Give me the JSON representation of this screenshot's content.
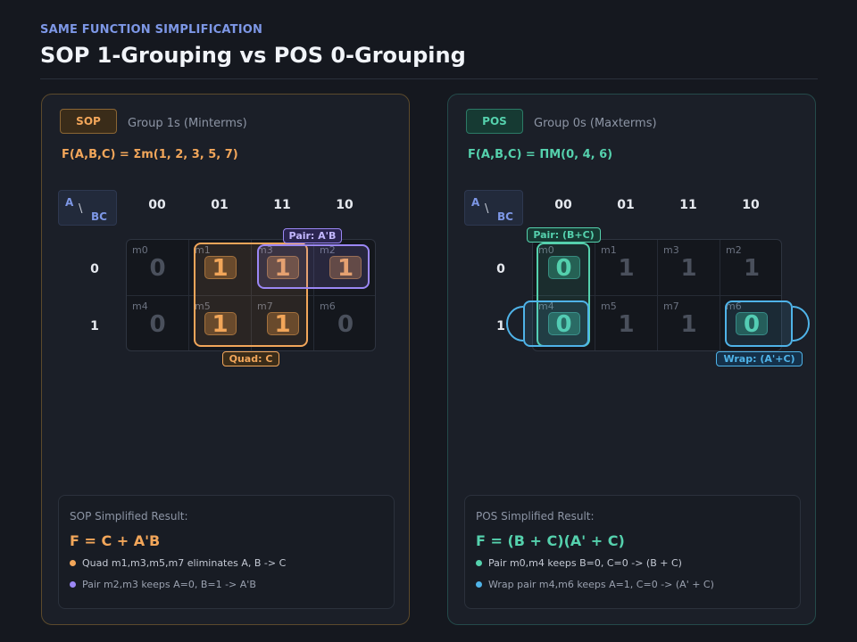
{
  "header": {
    "eyebrow": "SAME FUNCTION SIMPLIFICATION",
    "title": "SOP 1-Grouping vs POS 0-Grouping"
  },
  "kmap_axes": {
    "corner_a": "A",
    "corner_slash": "\\",
    "corner_bc": "BC",
    "columns": [
      "00",
      "01",
      "11",
      "10"
    ],
    "rows": [
      "0",
      "1"
    ]
  },
  "sop": {
    "badge": "SOP",
    "subtitle": "Group 1s (Minterms)",
    "function": "F(A,B,C) = Σm(1, 2, 3, 5, 7)",
    "cells": [
      [
        {
          "label": "m0",
          "value": "0"
        },
        {
          "label": "m1",
          "value": "1"
        },
        {
          "label": "m3",
          "value": "1"
        },
        {
          "label": "m2",
          "value": "1"
        }
      ],
      [
        {
          "label": "m4",
          "value": "0"
        },
        {
          "label": "m5",
          "value": "1"
        },
        {
          "label": "m7",
          "value": "1"
        },
        {
          "label": "m6",
          "value": "0"
        }
      ]
    ],
    "group_labels": {
      "pair": "Pair: A'B",
      "quad": "Quad: C"
    },
    "colors": {
      "quad": "#f2a65a",
      "pair": "#9b87f5"
    },
    "result": {
      "title": "SOP Simplified Result:",
      "equation": "F = C + A'B",
      "bullets": [
        "Quad m1,m3,m5,m7 eliminates A, B -> C",
        "Pair m2,m3 keeps A=0, B=1 -> A'B"
      ]
    }
  },
  "pos": {
    "badge": "POS",
    "subtitle": "Group 0s (Maxterms)",
    "function": "F(A,B,C) = ΠM(0, 4, 6)",
    "cells": [
      [
        {
          "label": "m0",
          "value": "0"
        },
        {
          "label": "m1",
          "value": "1"
        },
        {
          "label": "m3",
          "value": "1"
        },
        {
          "label": "m2",
          "value": "1"
        }
      ],
      [
        {
          "label": "m4",
          "value": "0"
        },
        {
          "label": "m5",
          "value": "1"
        },
        {
          "label": "m7",
          "value": "1"
        },
        {
          "label": "m6",
          "value": "0"
        }
      ]
    ],
    "group_labels": {
      "pair": "Pair: (B+C)",
      "wrap": "Wrap: (A'+C)"
    },
    "colors": {
      "pair": "#55d1ad",
      "wrap": "#4fb3e8"
    },
    "result": {
      "title": "POS Simplified Result:",
      "equation": "F = (B + C)(A' + C)",
      "bullets": [
        "Pair m0,m4 keeps B=0, C=0 -> (B + C)",
        "Wrap pair m4,m6 keeps A=1, C=0 -> (A' + C)"
      ]
    }
  }
}
